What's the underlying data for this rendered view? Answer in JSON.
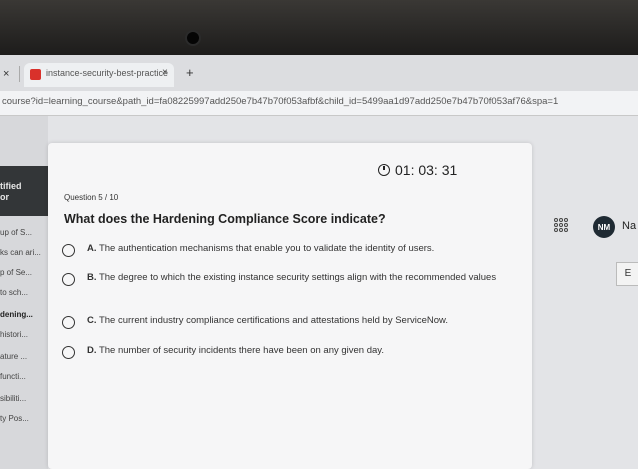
{
  "browser": {
    "prev_tab_close": "×",
    "tab_title": "instance-security-best-practice",
    "tab_close": "×",
    "new_tab": "+",
    "url": "course?id=learning_course&path_id=fa08225997add250e7b47b70f053afbf&child_id=5499aa1d97add250e7b47b70f053af76&spa=1"
  },
  "sidebar": {
    "header_line1": "tified",
    "header_line2": "or",
    "items": [
      {
        "label": "up of S..."
      },
      {
        "label": "ks can ari..."
      },
      {
        "label": "p of Se..."
      },
      {
        "label": "to sch..."
      },
      {
        "label": "dening..."
      },
      {
        "label": "histori..."
      },
      {
        "label": "ature ..."
      },
      {
        "label": "functi..."
      },
      {
        "label": "sibiliti..."
      },
      {
        "label": "ty Pos..."
      }
    ]
  },
  "timer": "01: 03: 31",
  "question": {
    "number": "Question 5 / 10",
    "text": "What does the Hardening Compliance Score indicate?",
    "options": [
      {
        "letter": "A.",
        "text": "The authentication mechanisms that enable you to validate the identity of users."
      },
      {
        "letter": "B.",
        "text": "The degree to which the existing instance security settings align with the recommended values"
      },
      {
        "letter": "C.",
        "text": "The current industry compliance certifications and attestations held by ServiceNow."
      },
      {
        "letter": "D.",
        "text": "The number of security incidents there have been on any given day."
      }
    ]
  },
  "header_right": {
    "avatar_initials": "NM",
    "user_name": "Na",
    "side_button": "E"
  }
}
